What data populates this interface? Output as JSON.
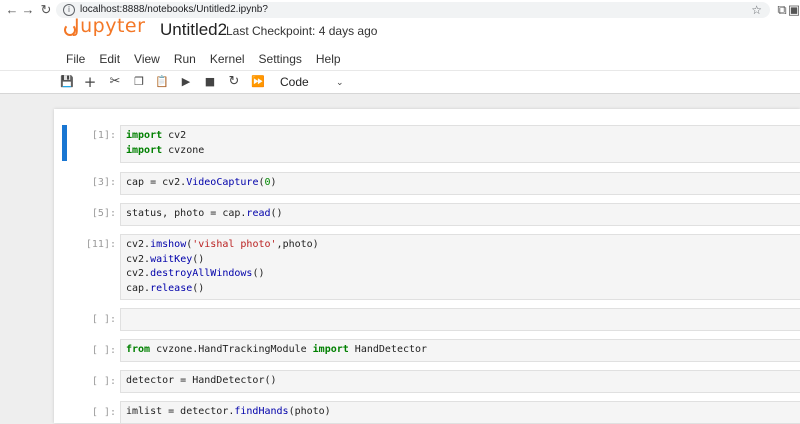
{
  "browser": {
    "url": "localhost:8888/notebooks/Untitled2.ipynb?",
    "icons": [
      "back-icon",
      "forward-icon",
      "reload-icon",
      "site-info-icon",
      "bookmark-star-icon",
      "extensions-icon",
      "split-view-icon"
    ]
  },
  "header": {
    "logo_text": "Jupyter",
    "notebook_title": "Untitled2",
    "checkpoint": "Last Checkpoint: 4 days ago"
  },
  "menu": [
    "File",
    "Edit",
    "View",
    "Run",
    "Kernel",
    "Settings",
    "Help"
  ],
  "toolbar": {
    "buttons": [
      "save-icon",
      "add-icon",
      "cut-icon",
      "copy-icon",
      "paste-icon",
      "run-icon",
      "stop-icon",
      "restart-icon",
      "fast-forward-icon"
    ],
    "cell_type": "Code"
  },
  "accent_color": "#1976d2",
  "cells": [
    {
      "prompt": "[1]:",
      "lines": [
        "import cv2",
        "import cvzone"
      ]
    },
    {
      "prompt": "[3]:",
      "lines": [
        "cap = cv2.VideoCapture(0)"
      ]
    },
    {
      "prompt": "[5]:",
      "lines": [
        "status, photo = cap.read()"
      ]
    },
    {
      "prompt": "[11]:",
      "lines": [
        "cv2.imshow('vishal photo',photo)",
        "cv2.waitKey()",
        "cv2.destroyAllWindows()",
        "cap.release()"
      ]
    },
    {
      "prompt": "[ ]:",
      "lines": [
        ""
      ]
    },
    {
      "prompt": "[ ]:",
      "lines": [
        "from cvzone.HandTrackingModule import HandDetector"
      ]
    },
    {
      "prompt": "[ ]:",
      "lines": [
        "detector = HandDetector()"
      ]
    },
    {
      "prompt": "[ ]:",
      "lines": [
        "imlist = detector.findHands(photo)"
      ]
    }
  ]
}
